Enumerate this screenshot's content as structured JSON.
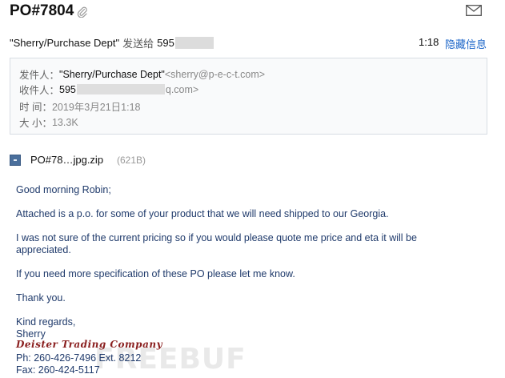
{
  "header": {
    "subject": "PO#7804",
    "from_display": "\"Sherry/Purchase Dept\"",
    "sent_to_label": "发送给",
    "recipient_partial": "595",
    "time": "1:18",
    "hide_info_label": "隐藏信息"
  },
  "details": {
    "from_label": "发件人：",
    "from_name": "\"Sherry/Purchase Dept\"",
    "from_email": "<sherry@p-e-c-t.com>",
    "to_label": "收件人：",
    "to_prefix": "595",
    "to_suffix": "q.com>",
    "time_label": "时  间：",
    "time_value": "2019年3月21日1:18",
    "size_label": "大  小：",
    "size_value": "13.3K"
  },
  "attachment": {
    "name": "PO#78…jpg.zip",
    "size": "(621B)"
  },
  "body": {
    "greeting": "Good morning Robin;",
    "p1": "Attached is a p.o. for some of your product that we will need shipped to our Georgia.",
    "p2": "I was not sure of the current pricing so if you would please quote me price and eta it will be appreciated.",
    "p3": "If you need more specification of these PO please let me know.",
    "p4": "Thank you.",
    "closing": "Kind regards,",
    "name": "Sherry",
    "company": "Deister Trading Company",
    "phone": "Ph: 260-426-7496 Ext. 8212",
    "fax": "Fax: 260-424-5117"
  },
  "watermark": "FREEBUF",
  "icons": {
    "attachment": "paperclip-icon",
    "mail": "envelope-icon",
    "file": "zip-file-icon"
  }
}
